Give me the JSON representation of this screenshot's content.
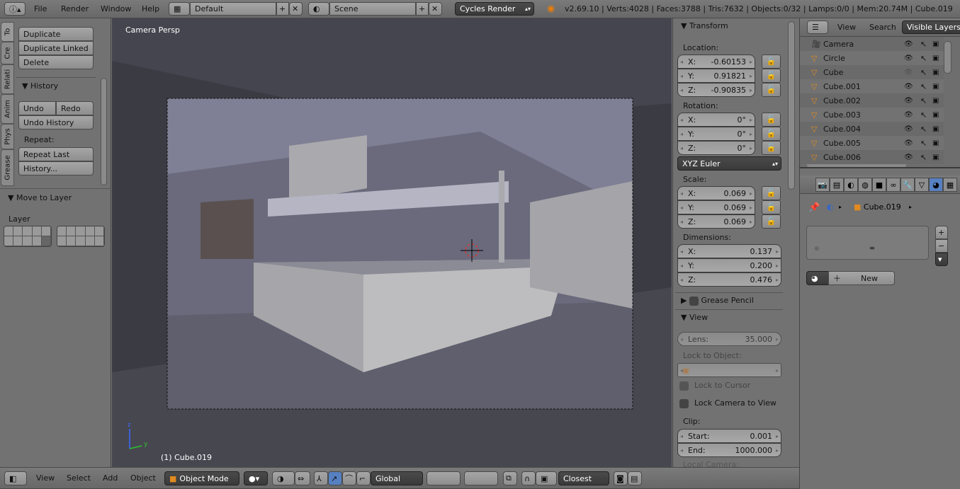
{
  "top_header": {
    "menus": [
      "File",
      "Render",
      "Window",
      "Help"
    ],
    "layout": "Default",
    "scene": "Scene",
    "engine": "Cycles Render",
    "stats": "v2.69.10 | Verts:4028 | Faces:3788 | Tris:7632 | Objects:0/32 | Lamps:0/0 | Mem:20.74M | Cube.019"
  },
  "tool_tabs": [
    "To",
    "Cre",
    "Relati",
    "Anim",
    "Phys",
    "Grease"
  ],
  "tool_panel": {
    "edit_buttons": [
      "Duplicate",
      "Duplicate Linked",
      "Delete"
    ],
    "history_title": "History",
    "undo": "Undo",
    "redo": "Redo",
    "undo_history": "Undo History",
    "repeat_label": "Repeat:",
    "repeat_last": "Repeat Last",
    "history_btn": "History...",
    "move_to_layer": "Move to Layer",
    "layer_label": "Layer",
    "active_layer": 10
  },
  "viewport": {
    "view_name": "Camera Persp",
    "object_info": "(1) Cube.019",
    "axis_x": "x",
    "axis_y": "y",
    "axis_z": "z"
  },
  "n_panel": {
    "transform_title": "Transform",
    "location_label": "Location:",
    "location": [
      {
        "a": "X:",
        "v": "-0.60153"
      },
      {
        "a": "Y:",
        "v": "0.91821"
      },
      {
        "a": "Z:",
        "v": "-0.90835"
      }
    ],
    "rotation_label": "Rotation:",
    "rotation": [
      {
        "a": "X:",
        "v": "0°"
      },
      {
        "a": "Y:",
        "v": "0°"
      },
      {
        "a": "Z:",
        "v": "0°"
      }
    ],
    "rotation_mode": "XYZ Euler",
    "scale_label": "Scale:",
    "scale": [
      {
        "a": "X:",
        "v": "0.069"
      },
      {
        "a": "Y:",
        "v": "0.069"
      },
      {
        "a": "Z:",
        "v": "0.069"
      }
    ],
    "dimensions_label": "Dimensions:",
    "dimensions": [
      {
        "a": "X:",
        "v": "0.137"
      },
      {
        "a": "Y:",
        "v": "0.200"
      },
      {
        "a": "Z:",
        "v": "0.476"
      }
    ],
    "grease_pencil": "Grease Pencil",
    "view_title": "View",
    "lens_label": "Lens:",
    "lens": "35.000",
    "lock_object_label": "Lock to Object:",
    "lock_cursor": "Lock to Cursor",
    "lock_camera": "Lock Camera to View",
    "clip_label": "Clip:",
    "clip_start_label": "Start:",
    "clip_start": "0.001",
    "clip_end_label": "End:",
    "clip_end": "1000.000",
    "local_camera": "Local Camera:"
  },
  "outliner": {
    "menus": [
      "View",
      "Search"
    ],
    "filter": "Visible Layers",
    "items": [
      "Camera",
      "Circle",
      "Cube",
      "Cube.001",
      "Cube.002",
      "Cube.003",
      "Cube.004",
      "Cube.005",
      "Cube.006"
    ]
  },
  "properties": {
    "tabs": [
      "render",
      "render-layers",
      "scene",
      "world",
      "object",
      "constraints",
      "modifiers",
      "data",
      "material",
      "texture"
    ],
    "active_tab": "material",
    "breadcrumb_object": "Cube.019",
    "new_button": "New"
  },
  "bottom_header": {
    "menus": [
      "View",
      "Select",
      "Add",
      "Object"
    ],
    "mode": "Object Mode",
    "orientation": "Global",
    "snap_target": "Closest"
  },
  "colors": {
    "accent": "#5680c2",
    "outline_orange": "#e08a20"
  }
}
